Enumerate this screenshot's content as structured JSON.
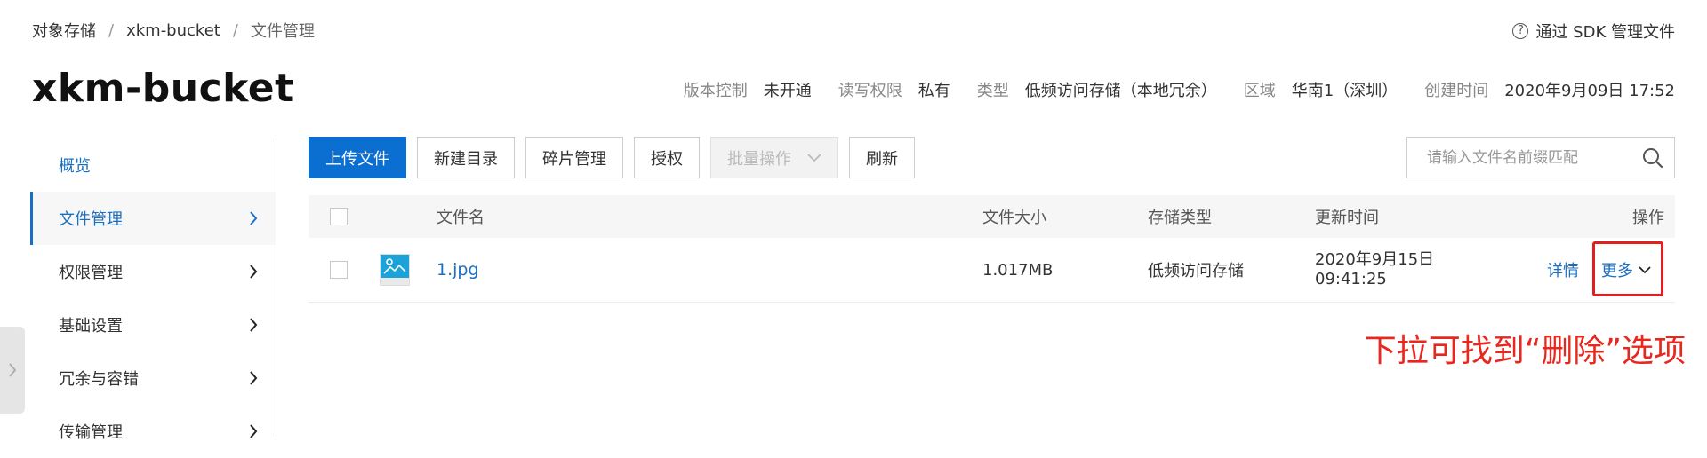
{
  "breadcrumb": {
    "items": [
      "对象存储",
      "xkm-bucket",
      "文件管理"
    ],
    "separator": "/"
  },
  "sdk_link": {
    "icon": "question-circle-icon",
    "label": "通过 SDK 管理文件"
  },
  "bucket": {
    "title": "xkm-bucket",
    "meta": [
      {
        "key": "版本控制",
        "value": "未开通"
      },
      {
        "key": "读写权限",
        "value": "私有"
      },
      {
        "key": "类型",
        "value": "低频访问存储（本地冗余）"
      },
      {
        "key": "区域",
        "value": "华南1（深圳）"
      },
      {
        "key": "创建时间",
        "value": "2020年9月09日 17:52"
      }
    ]
  },
  "sidebar": {
    "items": [
      {
        "label": "概览"
      },
      {
        "label": "文件管理"
      },
      {
        "label": "权限管理"
      },
      {
        "label": "基础设置"
      },
      {
        "label": "冗余与容错"
      },
      {
        "label": "传输管理"
      }
    ]
  },
  "toolbar": {
    "upload": "上传文件",
    "new_dir": "新建目录",
    "fragments": "碎片管理",
    "authorize": "授权",
    "batch": "批量操作",
    "refresh": "刷新"
  },
  "search": {
    "placeholder": "请输入文件名前缀匹配"
  },
  "table": {
    "headers": {
      "name": "文件名",
      "size": "文件大小",
      "storage": "存储类型",
      "updated": "更新时间",
      "ops": "操作"
    },
    "rows": [
      {
        "name": "1.jpg",
        "size": "1.017MB",
        "storage": "低频访问存储",
        "updated_date": "2020年9月15日",
        "updated_time": "09:41:25",
        "detail": "详情",
        "more": "更多"
      }
    ]
  },
  "annotation": {
    "text": "下拉可找到“删除”选项"
  },
  "colors": {
    "accent": "#0a6fd0",
    "link": "#1a6fc1",
    "annotation": "#e8281e"
  }
}
